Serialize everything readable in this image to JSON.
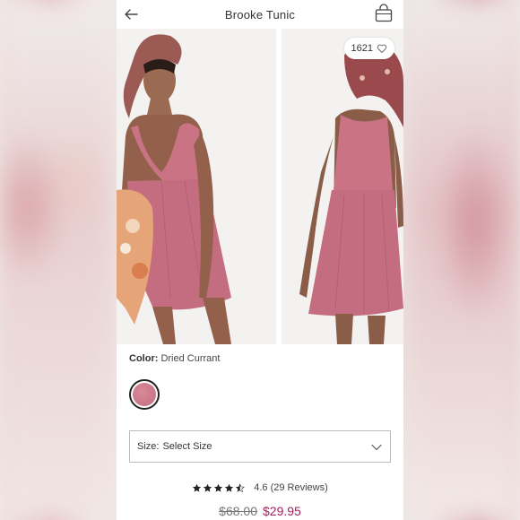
{
  "header": {
    "title": "Brooke Tunic",
    "back_icon": "arrow-left-icon",
    "bag_icon": "shopping-bag-icon"
  },
  "gallery": {
    "likes_count": "1621",
    "likes_icon": "heart-icon"
  },
  "product": {
    "color_label": "Color:",
    "color_value": "Dried Currant",
    "swatch_color": "#c97385",
    "size_label": "Size:",
    "size_value": "Select Size",
    "size_icon": "chevron-down-icon",
    "rating_value": 4.6,
    "rating_text": "4.6 (29 Reviews)",
    "original_price": "$68.00",
    "sale_price": "$29.95"
  },
  "colors": {
    "sale": "#a2245d",
    "dress": "#c97385"
  }
}
